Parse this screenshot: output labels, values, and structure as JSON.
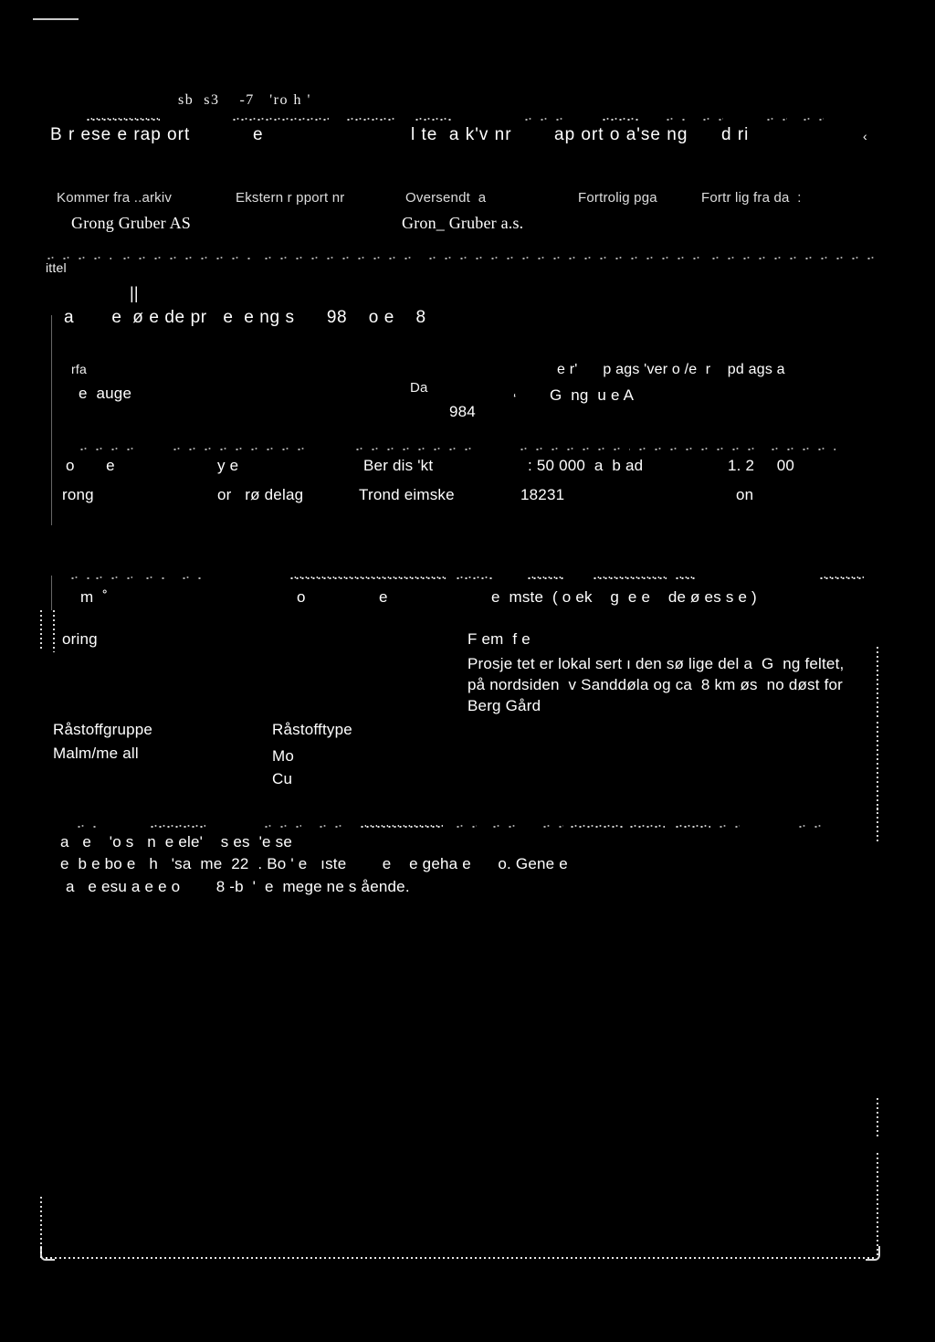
{
  "document": {
    "kind": "scanned-report-cover-sheet",
    "archive_stamp": "sb  s3    -7   'ro h '",
    "header_row": {
      "report_no_label": "B r ese e rap ort",
      "report_no_value": "e",
      "archive_no_label": "l te  a k'v nr",
      "location_label": "ap ort o a'se ng",
      "grading_label": "d ri"
    },
    "origin_row": {
      "from_archive_label": "Kommer fra ..arkiv",
      "from_archive_value": "Grong Gruber AS",
      "external_report_label": "Ekstern r pport nr",
      "external_report_value": "",
      "sent_from_label": "Oversendt  a",
      "sent_from_value": "Gron_ Gruber a.s.",
      "confidential_label": "Fortrolig pga",
      "confidential_value": "",
      "confidential_from_label": "Fortr lig fra da  :",
      "confidential_from_value": ""
    },
    "title_row": {
      "label": "ittel",
      "value": "a       e  ø e de pr   e  e ng s      98    o e    8"
    },
    "author_row": {
      "author_label": "rfa",
      "author_value": "e  auge",
      "date_label": "Da",
      "date_value": "984",
      "company_label": "e r'      p ags 'ver o /e  r    pd ags a",
      "company_value": "G  ng  u e A"
    },
    "geo_row": {
      "kommune_label": "o       e",
      "kommune_value": "rong",
      "fylke_label": "y e",
      "fylke_value": "or   rø delag",
      "bergdistrikt_label": "Ber dis 'kt",
      "bergdistrikt_value": "Trond eimske",
      "map50_label": ": 50 000  a  b ad",
      "map50_value": "18231",
      "map250_label": "1. 2     00",
      "map250_value": "on"
    },
    "fagomrade_row": {
      "label_left": "m  ˚",
      "label_mid_a": "o",
      "label_mid_b": "e",
      "label_right": "e  mste  ( o ek    g  e e    de ø es s e )",
      "value_left": "oring",
      "value_right_first": "F em  f e",
      "description": [
        "Prosje tet er lokal sert ı den sø lige del a  G  ng feltet,",
        "på nordsiden  v Sanddøla og ca  8 km øs  no døst for",
        "Berg Gård"
      ]
    },
    "raw_material": {
      "group_label": "Råstoffgruppe",
      "group_value": "Malm/me all",
      "type_label": "Råstofftype",
      "type_values": [
        "Mo",
        "Cu"
      ]
    },
    "summary": {
      "label": "a   e    'o s   n  e ele'    s es  'e se",
      "lines": [
        "e  b e bo e   h   'sa  me  22  . Bo ' e   ıste        e    e geha e      o. Gene e",
        "a   e esu a e e o        8 -b  '  e  mege ne s ående."
      ]
    }
  },
  "colors": {
    "page_background": "#000000",
    "ink": "#ffffff",
    "rule": "#bdbdbd"
  }
}
